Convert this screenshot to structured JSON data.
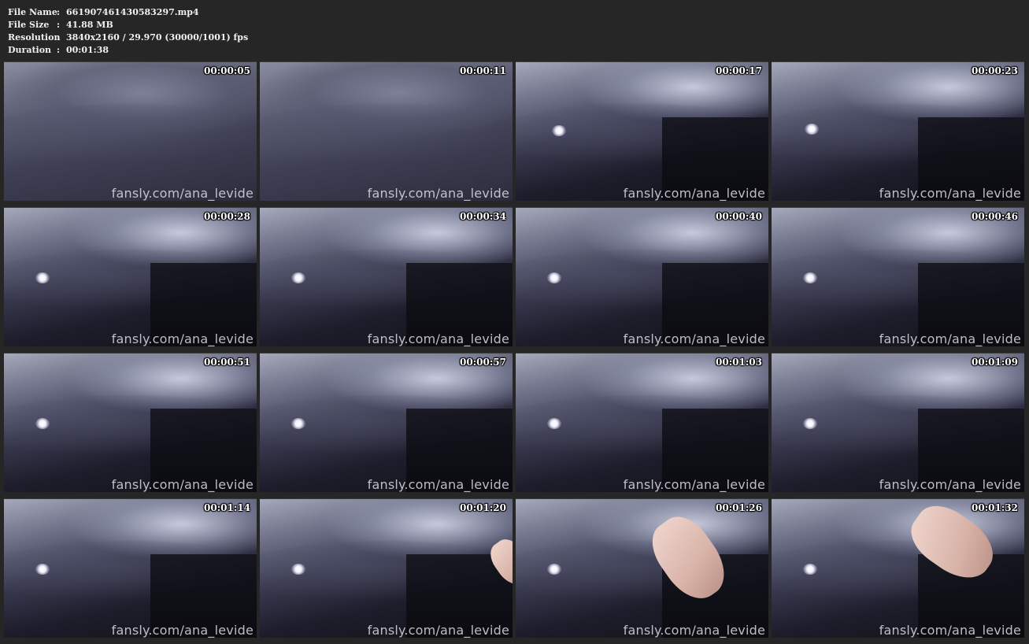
{
  "info": {
    "file_name_label": "File Name",
    "file_name_value": "661907461430583297.mp4",
    "file_size_label": "File Size",
    "file_size_value": "41.88 MB",
    "resolution_label": "Resolution",
    "resolution_value": "3840x2160 / 29.970 (30000/1001) fps",
    "duration_label": "Duration",
    "duration_value": "00:01:38",
    "separator": ":"
  },
  "watermark": "fansly.com/ana_levide",
  "thumbnails": [
    {
      "time": "00:00:05"
    },
    {
      "time": "00:00:11"
    },
    {
      "time": "00:00:17"
    },
    {
      "time": "00:00:23"
    },
    {
      "time": "00:00:28"
    },
    {
      "time": "00:00:34"
    },
    {
      "time": "00:00:40"
    },
    {
      "time": "00:00:46"
    },
    {
      "time": "00:00:51"
    },
    {
      "time": "00:00:57"
    },
    {
      "time": "00:01:03"
    },
    {
      "time": "00:01:09"
    },
    {
      "time": "00:01:14"
    },
    {
      "time": "00:01:20"
    },
    {
      "time": "00:01:26"
    },
    {
      "time": "00:01:32"
    }
  ]
}
